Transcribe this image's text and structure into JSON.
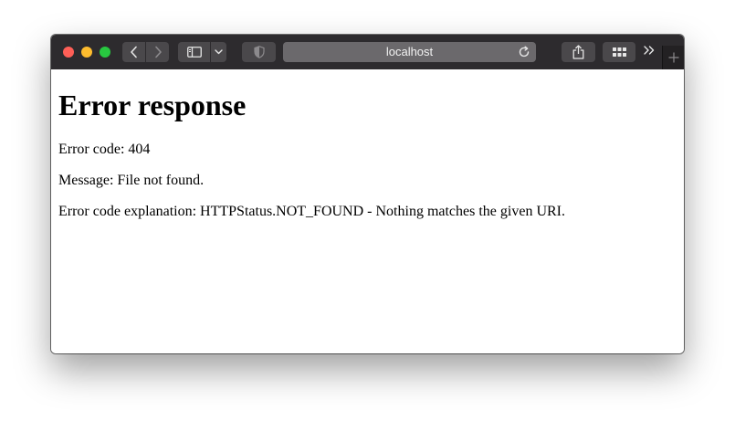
{
  "browser": {
    "address": "localhost"
  },
  "page": {
    "heading": "Error response",
    "lines": [
      "Error code: 404",
      "Message: File not found.",
      "Error code explanation: HTTPStatus.NOT_FOUND - Nothing matches the given URI."
    ]
  },
  "icons": {
    "close": "close-light",
    "minimize": "minimize-light",
    "zoom": "zoom-light",
    "back": "chevron-left-icon",
    "forward": "chevron-right-icon",
    "sidebar": "sidebar-icon",
    "sidebar_menu": "chevron-down-icon",
    "privacy": "shield-icon",
    "reload": "reload-icon",
    "share": "share-icon",
    "tab_overview": "grid-icon",
    "overflow": "double-chevron-icon",
    "new_tab": "plus-icon"
  },
  "colors": {
    "toolbar": "#2d2b2e",
    "close": "#ff5f57",
    "minimize": "#febc2e",
    "zoom": "#28c840"
  }
}
